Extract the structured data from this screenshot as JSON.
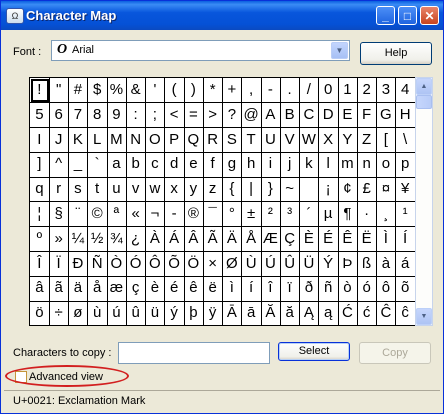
{
  "window": {
    "title": "Character Map"
  },
  "font": {
    "label": "Font :",
    "glyph": "O",
    "value": "Arial"
  },
  "help_label": "Help",
  "grid": {
    "rows": [
      [
        "!",
        "\"",
        "#",
        "$",
        "%",
        "&",
        "'",
        "(",
        ")",
        "*",
        "+",
        ",",
        "-",
        ".",
        "/",
        "0",
        "1",
        "2",
        "3",
        "4"
      ],
      [
        "5",
        "6",
        "7",
        "8",
        "9",
        ":",
        ";",
        "<",
        "=",
        ">",
        "?",
        "@",
        "A",
        "B",
        "C",
        "D",
        "E",
        "F",
        "G",
        "H"
      ],
      [
        "I",
        "J",
        "K",
        "L",
        "M",
        "N",
        "O",
        "P",
        "Q",
        "R",
        "S",
        "T",
        "U",
        "V",
        "W",
        "X",
        "Y",
        "Z",
        "[",
        "\\"
      ],
      [
        "]",
        "^",
        "_",
        "`",
        "a",
        "b",
        "c",
        "d",
        "e",
        "f",
        "g",
        "h",
        "i",
        "j",
        "k",
        "l",
        "m",
        "n",
        "o",
        "p"
      ],
      [
        "q",
        "r",
        "s",
        "t",
        "u",
        "v",
        "w",
        "x",
        "y",
        "z",
        "{",
        "|",
        "}",
        "~",
        " ",
        "¡",
        "¢",
        "£",
        "¤",
        "¥"
      ],
      [
        "¦",
        "§",
        "¨",
        "©",
        "ª",
        "«",
        "¬",
        "-",
        "®",
        "¯",
        "°",
        "±",
        "²",
        "³",
        "´",
        "µ",
        "¶",
        "·",
        "¸",
        "¹"
      ],
      [
        "º",
        "»",
        "¼",
        "½",
        "¾",
        "¿",
        "À",
        "Á",
        "Â",
        "Ã",
        "Ä",
        "Å",
        "Æ",
        "Ç",
        "È",
        "É",
        "Ê",
        "Ë",
        "Ì",
        "Í"
      ],
      [
        "Î",
        "Ï",
        "Ð",
        "Ñ",
        "Ò",
        "Ó",
        "Ô",
        "Õ",
        "Ö",
        "×",
        "Ø",
        "Ù",
        "Ú",
        "Û",
        "Ü",
        "Ý",
        "Þ",
        "ß",
        "à",
        "á"
      ],
      [
        "â",
        "ã",
        "ä",
        "å",
        "æ",
        "ç",
        "è",
        "é",
        "ê",
        "ë",
        "ì",
        "í",
        "î",
        "ï",
        "ð",
        "ñ",
        "ò",
        "ó",
        "ô",
        "õ"
      ],
      [
        "ö",
        "÷",
        "ø",
        "ù",
        "ú",
        "û",
        "ü",
        "ý",
        "þ",
        "ÿ",
        "Ā",
        "ā",
        "Ă",
        "ă",
        "Ą",
        "ą",
        "Ć",
        "ć",
        "Ĉ",
        "ĉ"
      ]
    ]
  },
  "copy": {
    "label": "Characters to copy :",
    "value": ""
  },
  "select_label": "Select",
  "copy_label": "Copy",
  "advanced_view": {
    "label": "Advanced view",
    "checked": false
  },
  "status": "U+0021: Exclamation Mark",
  "colors": {
    "title_bar": "#0a5fe0",
    "dialog_bg": "#ece9d8",
    "highlight_ring": "#d21f1f"
  }
}
